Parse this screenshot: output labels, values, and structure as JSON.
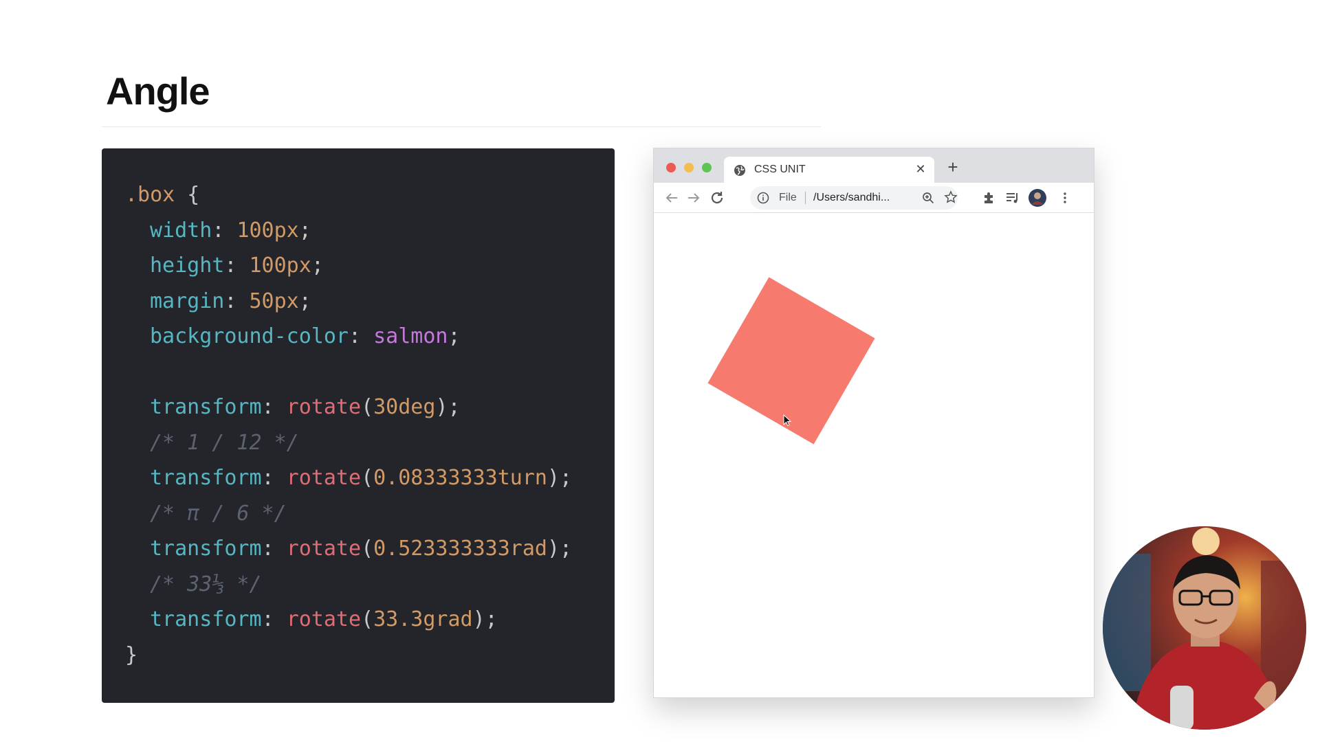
{
  "slide": {
    "title": "Angle"
  },
  "code": {
    "line1": {
      "selector": ".box",
      "brace": " {"
    },
    "line2": {
      "prop": "width",
      "value": "100px"
    },
    "line3": {
      "prop": "height",
      "value": "100px"
    },
    "line4": {
      "prop": "margin",
      "value": "50px"
    },
    "line5": {
      "prop": "background-color",
      "value": "salmon"
    },
    "line7": {
      "prop": "transform",
      "fn": "rotate",
      "arg": "30deg"
    },
    "line8": {
      "comment": "/* 1 / 12 */"
    },
    "line9": {
      "prop": "transform",
      "fn": "rotate",
      "arg": "0.08333333turn"
    },
    "line10": {
      "comment": "/* π / 6 */"
    },
    "line11": {
      "prop": "transform",
      "fn": "rotate",
      "arg": "0.523333333rad"
    },
    "line12": {
      "comment": "/* 33⅓ */"
    },
    "line13": {
      "prop": "transform",
      "fn": "rotate",
      "arg": "33.3grad"
    },
    "line14": {
      "brace": "}"
    }
  },
  "browser": {
    "tab_title": "CSS UNIT",
    "tab_close": "✕",
    "new_tab": "+",
    "omnibox_scheme": "File",
    "omnibox_url": "/Users/sandhi...",
    "box_color": "#f77a6f",
    "box_rotation_deg": 30
  },
  "icons": {
    "back": "back-arrow-icon",
    "forward": "forward-arrow-icon",
    "reload": "reload-icon",
    "info": "info-icon",
    "zoom": "zoom-icon",
    "star": "bookmark-star-icon",
    "extensions": "puzzle-icon",
    "media": "media-queue-icon",
    "profile": "avatar",
    "menu": "kebab-menu-icon"
  }
}
